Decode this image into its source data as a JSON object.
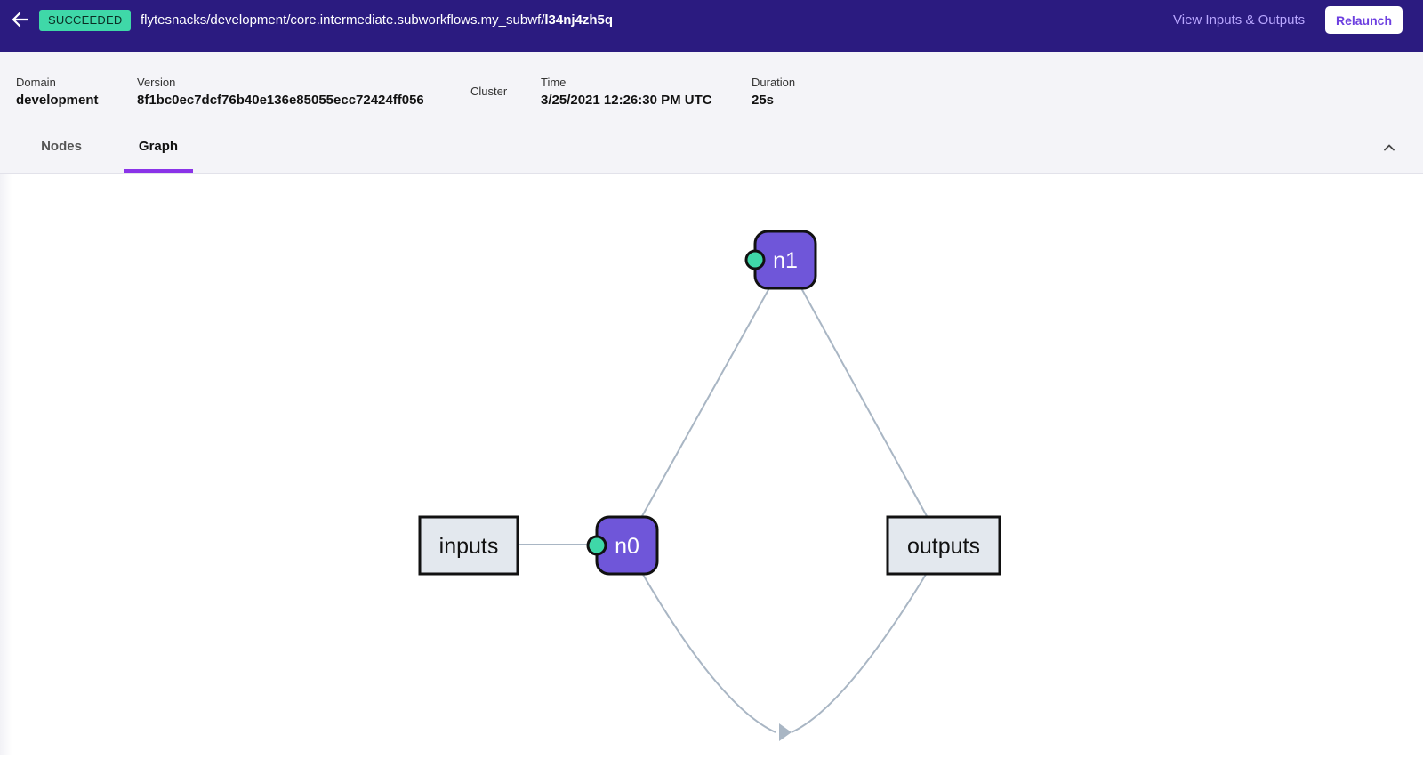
{
  "header": {
    "status": "SUCCEEDED",
    "path_prefix": "flytesnacks/development/core.intermediate.subworkflows.my_subwf/",
    "execution_id": "l34nj4zh5q",
    "io_link": "View Inputs & Outputs",
    "relaunch": "Relaunch"
  },
  "details": {
    "domain_label": "Domain",
    "domain_value": "development",
    "version_label": "Version",
    "version_value": "8f1bc0ec7dcf76b40e136e85055ecc72424ff056",
    "cluster_label": "Cluster",
    "time_label": "Time",
    "time_value": "3/25/2021 12:26:30 PM UTC",
    "duration_label": "Duration",
    "duration_value": "25s"
  },
  "tabs": {
    "nodes": "Nodes",
    "graph": "Graph"
  },
  "graph": {
    "nodes": [
      {
        "id": "inputs",
        "label": "inputs",
        "kind": "io"
      },
      {
        "id": "n0",
        "label": "n0",
        "kind": "task"
      },
      {
        "id": "n1",
        "label": "n1",
        "kind": "task"
      },
      {
        "id": "outputs",
        "label": "outputs",
        "kind": "io"
      }
    ],
    "colors": {
      "task": "#6f56d9",
      "io": "#e3e8ee",
      "status_dot": "#3fd8a8",
      "edge": "#a9b6c4"
    }
  }
}
